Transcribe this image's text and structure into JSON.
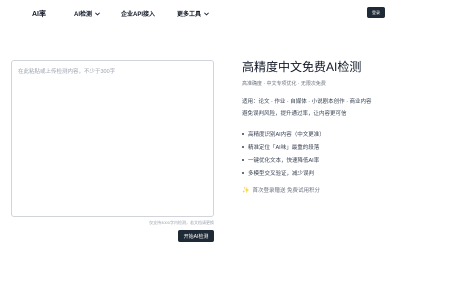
{
  "nav": {
    "logo": "AI率",
    "items": [
      {
        "label": "AI检测",
        "has_dropdown": true
      },
      {
        "label": "企业API接入",
        "has_dropdown": false
      },
      {
        "label": "更多工具",
        "has_dropdown": true
      }
    ],
    "login_label": "登录"
  },
  "editor": {
    "placeholder": "在此粘贴或上传检测内容，不少于300字",
    "hint": "仅支持3000字内检测，若文档请更换",
    "submit_label": "开始AI检测"
  },
  "side": {
    "title": "高精度中文免费AI检测",
    "subtitle": "高准确度 · 中文专项优化 · 无限次免费",
    "applies_line1": "适用：论文 · 作业 · 自媒体 · 小说剧本创作 · 商业内容",
    "applies_line2": "避免误判风险，提升通过率，让内容更可信",
    "features": [
      "高精度识别AI内容（中文更准）",
      "精准定位「AI味」最重的段落",
      "一键优化文本，快速降低AI率",
      "多模型交叉验证，减少误判"
    ],
    "promo_icon": "sparkle-icon",
    "promo_text": "首次登录赠送 免费试用积分"
  },
  "colors": {
    "primary_dark": "#1f2a37",
    "promo_icon": "#f5c518"
  }
}
